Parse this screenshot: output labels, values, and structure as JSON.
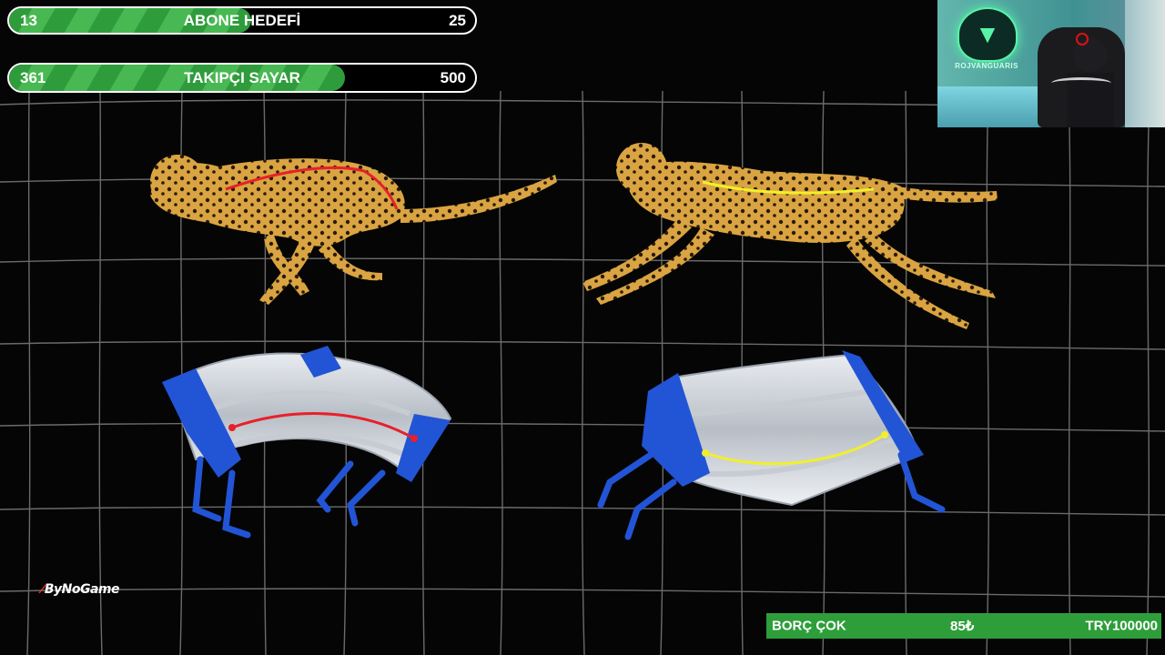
{
  "goals": {
    "subscriber": {
      "current": "13",
      "title": "ABONE HEDEFİ",
      "target": "25",
      "progress": 0.52
    },
    "follower": {
      "current": "361",
      "title": "TAKIPÇI SAYAR",
      "target": "500",
      "progress": 0.72
    }
  },
  "webcam": {
    "logo_text": "ROJVANGUARIS"
  },
  "brand": {
    "mark": "⁄",
    "label": "ByNoGame"
  },
  "donation": {
    "name": "BORÇ ÇOK",
    "amount": "85₺",
    "total": "TRY100000"
  },
  "colors": {
    "bar_green": "#3aaa48",
    "spine_red": "#e8202a",
    "spine_yellow": "#f2ef2a",
    "robot_blue": "#2254d6",
    "cheetah": "#d9a441"
  }
}
